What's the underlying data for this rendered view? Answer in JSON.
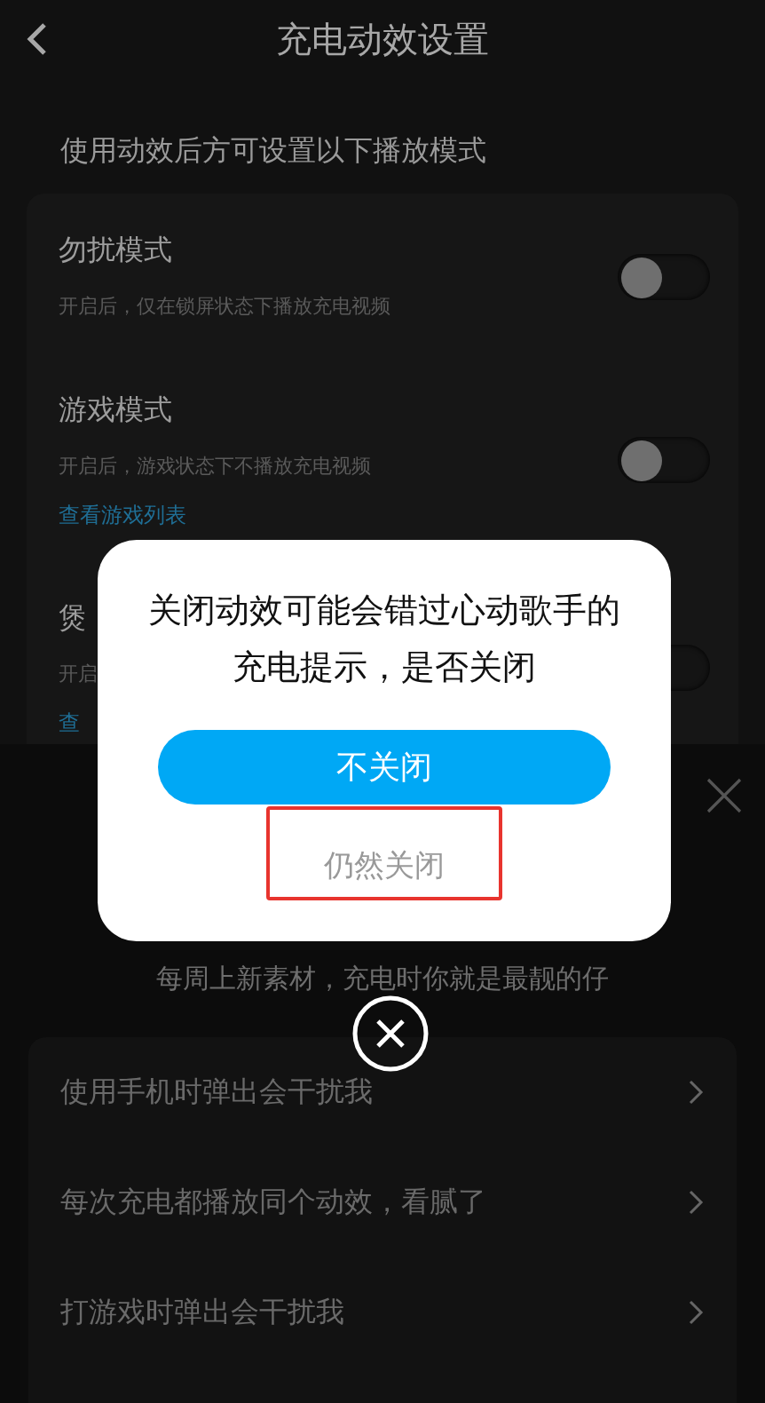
{
  "header": {
    "title": "充电动效设置"
  },
  "section_hint": "使用动效后方可设置以下播放模式",
  "modes": [
    {
      "title": "勿扰模式",
      "description": "开启后，仅在锁屏状态下播放充电视频",
      "on": false
    },
    {
      "title": "游戏模式",
      "description": "开启后，游戏状态下不播放充电视频",
      "link": "查看游戏列表",
      "on": false
    },
    {
      "title": "煲",
      "description": "开启",
      "link": "查",
      "on": false
    }
  ],
  "feedback_sheet": {
    "subtitle": "每周上新素材，充电时你就是最靓的仔",
    "reasons": [
      "使用手机时弹出会干扰我",
      "每次充电都播放同个动效，看腻了",
      "打游戏时弹出会干扰我"
    ]
  },
  "dialog": {
    "message": "关闭动效可能会错过心动歌手的充电提示，是否关闭",
    "confirm": "不关闭",
    "cancel": "仍然关闭"
  }
}
